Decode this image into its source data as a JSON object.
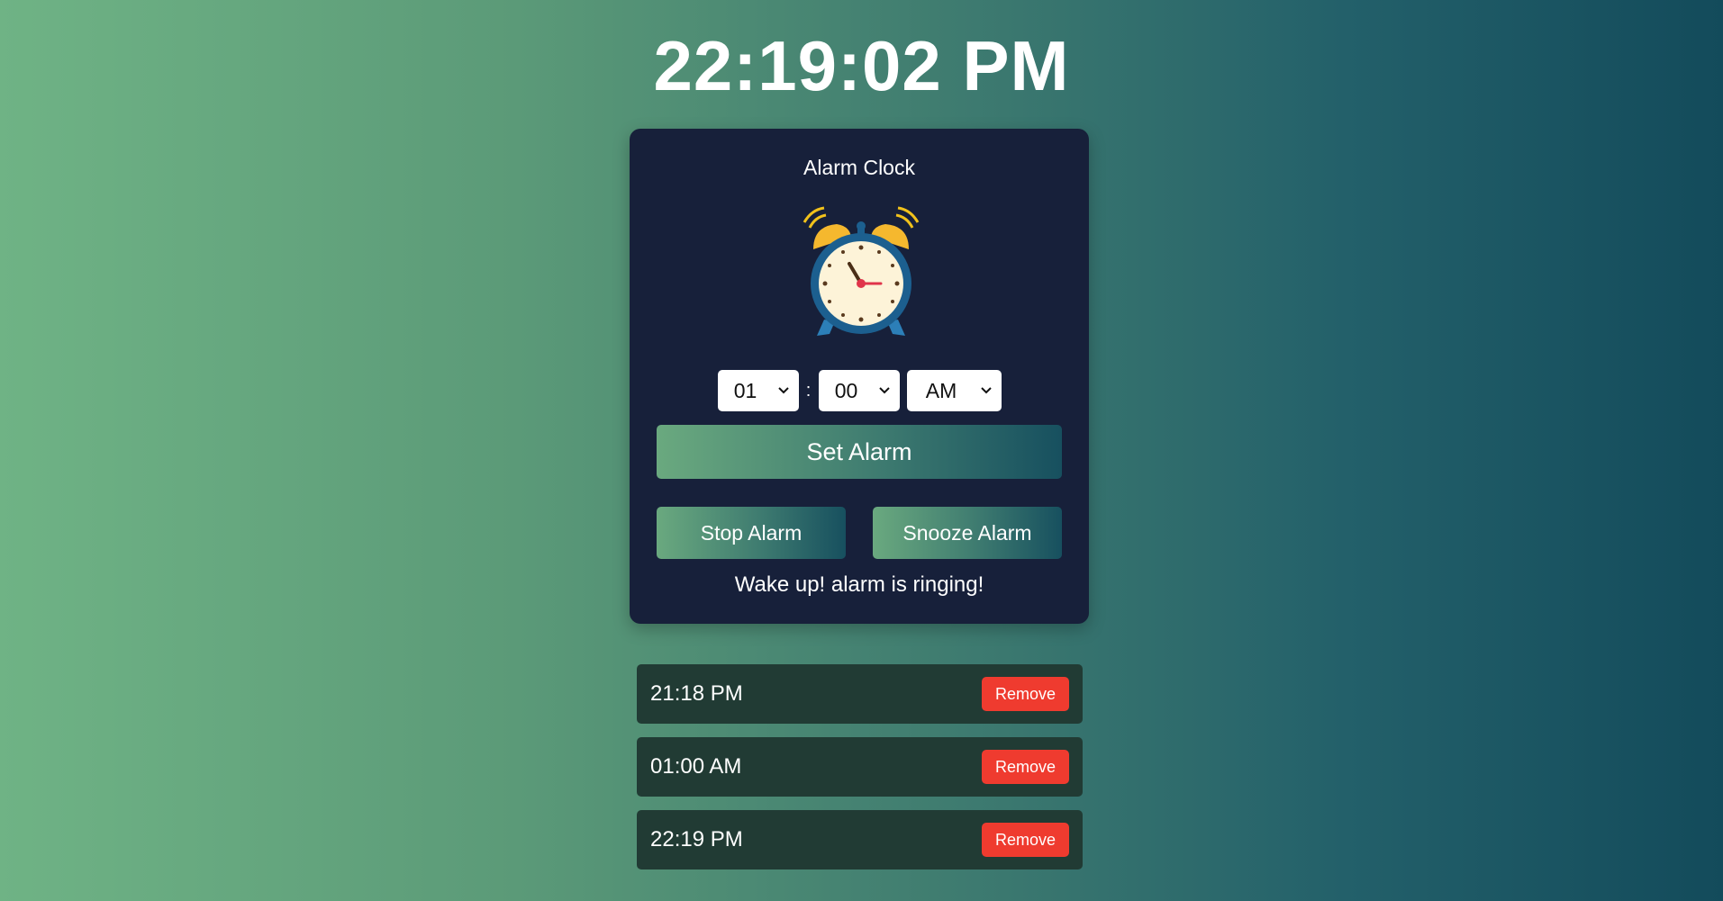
{
  "clock": {
    "time": "22:19:02 PM"
  },
  "card": {
    "title": "Alarm Clock",
    "icon": "alarm-clock-icon",
    "selects": {
      "hour": "01",
      "separator": ":",
      "minute": "00",
      "ampm": "AM"
    },
    "set_label": "Set Alarm",
    "stop_label": "Stop Alarm",
    "snooze_label": "Snooze Alarm",
    "status": "Wake up! alarm is ringing!"
  },
  "alarms": [
    {
      "time": "21:18 PM",
      "remove_label": "Remove"
    },
    {
      "time": "01:00 AM",
      "remove_label": "Remove"
    },
    {
      "time": "22:19 PM",
      "remove_label": "Remove"
    }
  ],
  "colors": {
    "card_bg": "#17203a",
    "alarm_row_bg": "#213b34",
    "remove_bg": "#ef3b2f",
    "gradient_start": "#6fb385",
    "gradient_end": "#134b5b"
  }
}
